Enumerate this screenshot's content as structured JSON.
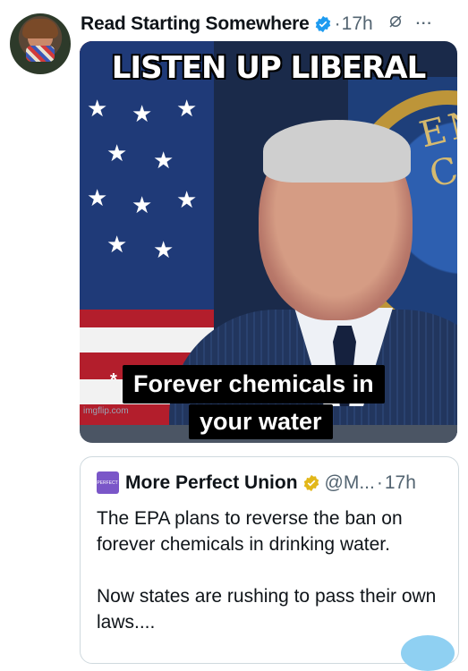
{
  "tweet": {
    "author_name": "Read Starting Somewhere",
    "separator": "·",
    "time": "17h",
    "grok_icon": "grok-icon",
    "more_icon": "more-icon",
    "more_label": "···"
  },
  "media": {
    "meme_top": "LISTEN UP LIBERAL",
    "caption_line1": "Forever chemicals in",
    "caption_line2": "your water",
    "asterisk": "*",
    "watermark": "imgflip.com",
    "seal_text": "ENT C"
  },
  "quote": {
    "logo_text": "MORE PERFECT UNION",
    "name": "More Perfect Union",
    "handle": "@M...",
    "separator": "·",
    "time": "17h",
    "paragraphs": [
      "The EPA plans to reverse the ban on forever chemicals in drinking water.",
      "Now states are rushing to pass their own laws...."
    ]
  },
  "colors": {
    "verified_blue": "#1d9bf0",
    "verified_gold": "#e2b719",
    "secondary_text": "#536471"
  }
}
